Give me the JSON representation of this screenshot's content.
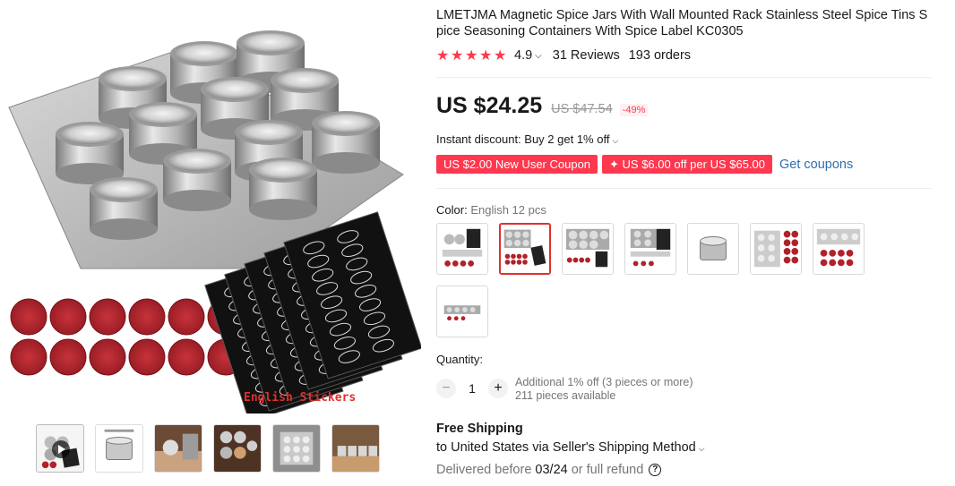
{
  "product": {
    "title": "LMETJMA Magnetic Spice Jars With Wall Mounted Rack Stainless Steel Spice Tins Spice Seasoning Containers With Spice Label KC0305",
    "rating": "4.9",
    "reviews": "31 Reviews",
    "orders": "193 orders",
    "price": "US $24.25",
    "old_price": "US $47.54",
    "discount": "-49%",
    "instant_discount": "Instant discount: Buy 2 get 1% off",
    "coupons": [
      "US $2.00 New User Coupon",
      "✦ US $6.00 off per US $65.00"
    ],
    "get_coupons": "Get coupons"
  },
  "gallery": {
    "caption": "English Stickers",
    "thumbnails": [
      "video",
      "jar-diagram",
      "kitchen-1",
      "kitchen-2",
      "fridge",
      "kitchen-3"
    ]
  },
  "color": {
    "label": "Color:",
    "selected": "English 12 pcs",
    "swatch_count": 8,
    "selected_index": 1
  },
  "quantity": {
    "label": "Quantity:",
    "value": "1",
    "minus": "−",
    "plus": "+",
    "note1": "Additional 1% off (3 pieces or more)",
    "note2": "211 pieces available"
  },
  "shipping": {
    "title": "Free Shipping",
    "to": "to United States via Seller's Shipping Method",
    "delivered_prefix": "Delivered before",
    "date": "03/24",
    "suffix": "or full refund",
    "help": "?"
  },
  "colors": {
    "accent": "#fd384f",
    "link": "#2e6fb3"
  }
}
